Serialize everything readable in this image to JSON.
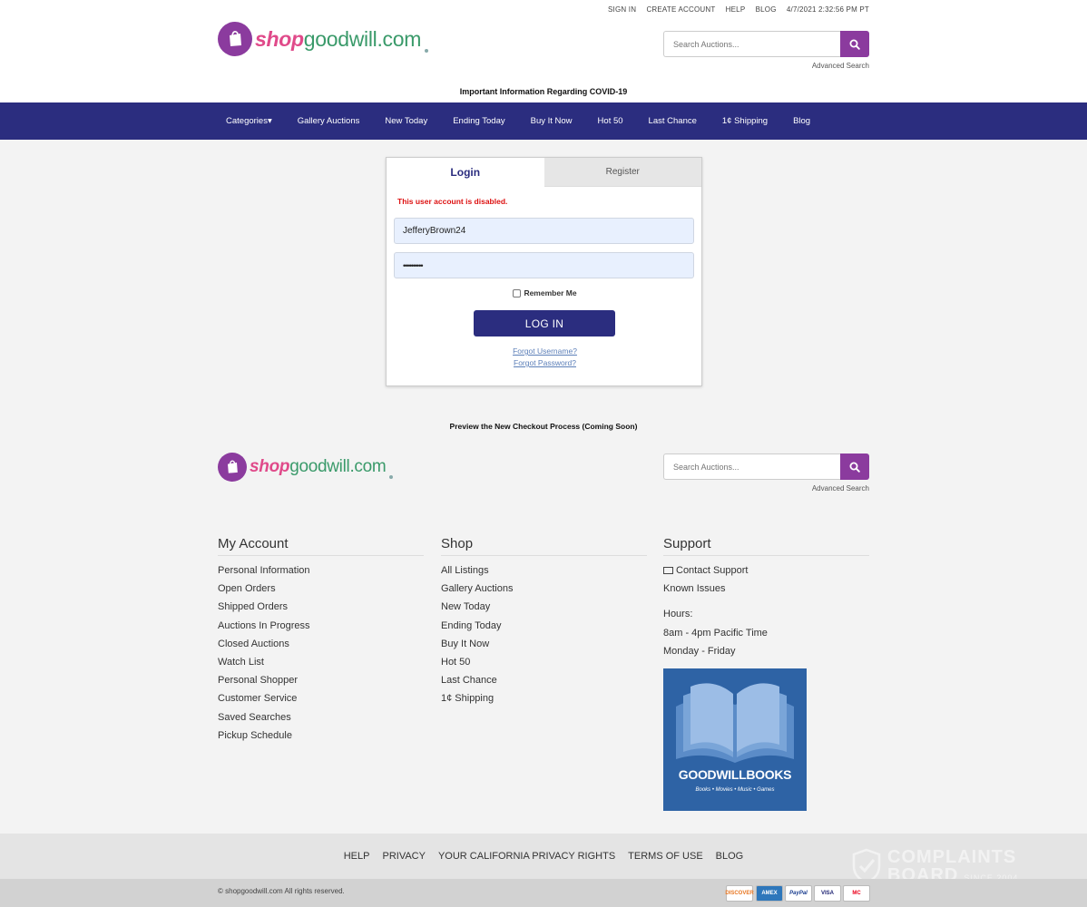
{
  "header": {
    "top_links": [
      "SIGN IN",
      "CREATE ACCOUNT",
      "HELP",
      "BLOG"
    ],
    "datetime": "4/7/2021 2:32:56 PM PT",
    "logo_part1": "shop",
    "logo_part2": "goodwill.com",
    "search_placeholder": "Search Auctions...",
    "advanced_search": "Advanced Search",
    "covid_notice": "Important Information Regarding COVID-19"
  },
  "nav": {
    "items": [
      "Categories▾",
      "Gallery Auctions",
      "New Today",
      "Ending Today",
      "Buy It Now",
      "Hot 50",
      "Last Chance",
      "1¢ Shipping",
      "Blog"
    ]
  },
  "login": {
    "tab_login": "Login",
    "tab_register": "Register",
    "error": "This user account is disabled.",
    "username_value": "JefferyBrown24",
    "password_value": "••••••••••",
    "remember_label": "Remember Me",
    "login_button": "LOG IN",
    "forgot_username": "Forgot Username?",
    "forgot_password": "Forgot Password?"
  },
  "preview_notice": "Preview the New Checkout Process (Coming Soon)",
  "footer": {
    "search_placeholder": "Search Auctions...",
    "advanced_search": "Advanced Search",
    "my_account": {
      "title": "My Account",
      "items": [
        "Personal Information",
        "Open Orders",
        "Shipped Orders",
        "Auctions In Progress",
        "Closed Auctions",
        "Watch List",
        "Personal Shopper",
        "Customer Service",
        "Saved Searches",
        "Pickup Schedule"
      ]
    },
    "shop": {
      "title": "Shop",
      "items": [
        "All Listings",
        "Gallery Auctions",
        "New Today",
        "Ending Today",
        "Buy It Now",
        "Hot 50",
        "Last Chance",
        "1¢ Shipping"
      ]
    },
    "support": {
      "title": "Support",
      "contact": "Contact Support",
      "known_issues": "Known Issues",
      "hours_label": "Hours:",
      "hours_time": "8am - 4pm Pacific Time",
      "hours_days": "Monday - Friday"
    },
    "books_banner": {
      "title": "GOODWILLBOOKS",
      "subtitle": "Books • Movies • Music • Games"
    },
    "legal_links": [
      "HELP",
      "PRIVACY",
      "YOUR CALIFORNIA PRIVACY RIGHTS",
      "TERMS OF USE",
      "BLOG"
    ],
    "copyright": "© shopgoodwill.com All rights reserved.",
    "payment_methods": [
      "DISCOVER",
      "AMEX",
      "PayPal",
      "VISA",
      "MC"
    ]
  },
  "watermark": {
    "line1": "COMPLAINTS",
    "line2": "BOARD",
    "line3": "SINCE 2004"
  },
  "colors": {
    "brand_purple": "#8b3b9e",
    "nav_blue": "#2b2d7f",
    "error_red": "#dd1111",
    "field_bg": "#e8f0fe"
  }
}
